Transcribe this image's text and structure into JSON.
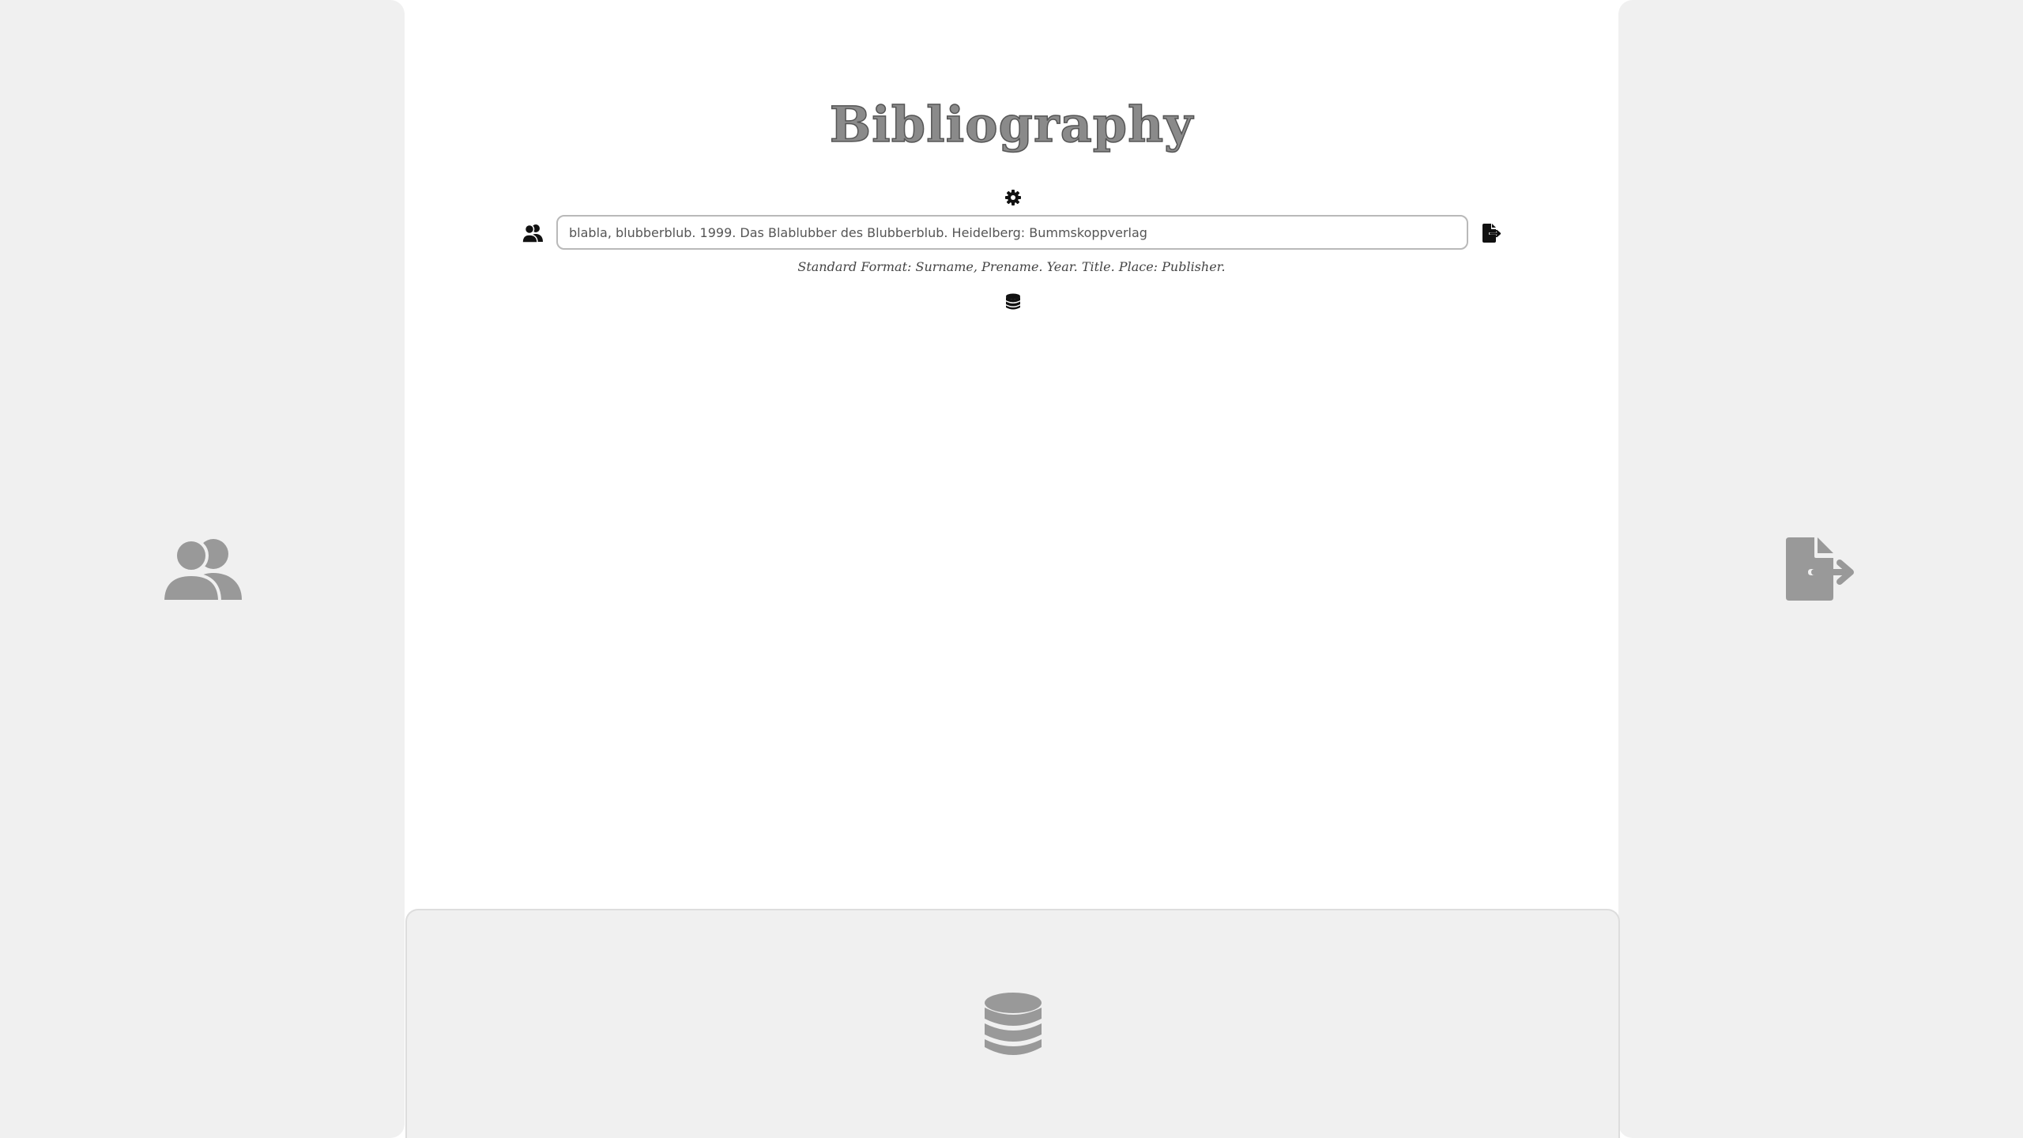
{
  "header": {
    "title": "Bibliography"
  },
  "entry": {
    "placeholder": "blabla, blubberblub. 1999. Das Blablubber des Blubberblub. Heidelberg: Bummskoppverlag",
    "value": "",
    "format_hint": "Standard Format: Surname, Prename. Year. Title. Place: Publisher."
  },
  "icons": {
    "settings": "gear-icon",
    "authors": "users-icon",
    "export": "file-export-icon",
    "database": "database-icon"
  },
  "colors": {
    "panel_bg": "#f0f0f0",
    "panel_icon": "#999999",
    "icon_dark": "#111111",
    "input_border": "#b9b9b9"
  }
}
